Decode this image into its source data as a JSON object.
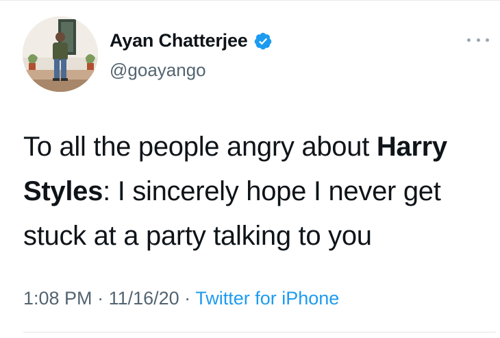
{
  "author": {
    "display_name": "Ayan Chatterjee",
    "handle": "@goayango",
    "verified": true,
    "verified_icon": "verified-badge-icon",
    "verified_color": "#1d9bf0"
  },
  "tweet": {
    "text_1": "To all the people angry about ",
    "bold_1": "Harry Styles",
    "text_2": ": I sincerely hope I never get stuck at a party talking to you"
  },
  "meta": {
    "time": "1:08 PM",
    "separator": " · ",
    "date": "11/16/20",
    "source": "Twitter for iPhone"
  },
  "more_icon": "more-options-icon",
  "colors": {
    "text": "#0f1419",
    "secondary": "#536471",
    "link": "#1d9bf0"
  }
}
